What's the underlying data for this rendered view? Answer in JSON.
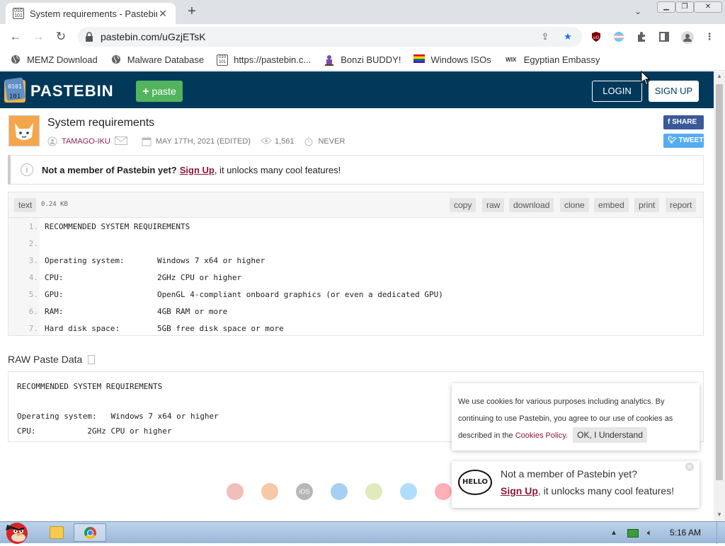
{
  "browser": {
    "tab_title": "System requirements - Pastebin",
    "tab_close": "✕",
    "new_tab": "+",
    "url": "pastebin.com/uGzjETsK",
    "bookmarks": [
      {
        "label": "MEMZ Download",
        "icon": "globe-icon"
      },
      {
        "label": "Malware Database",
        "icon": "globe-icon"
      },
      {
        "label": "https://pastebin.c...",
        "icon": "pastebin-icon"
      },
      {
        "label": "Bonzi BUDDY!",
        "icon": "bonzi-icon"
      },
      {
        "label": "Windows ISOs",
        "icon": "rainbow-flag-icon"
      },
      {
        "label": "Egyptian Embassy",
        "icon": "wix-icon"
      }
    ],
    "wix_glyph": "WIX"
  },
  "header": {
    "logo_text": "PASTEBIN",
    "paste_button": "paste",
    "login_button": "LOGIN",
    "signup_button": "SIGN UP",
    "logo_digits": "0101"
  },
  "paste": {
    "title": "System requirements",
    "author": "TAMAGO-IKU",
    "date": "MAY 17TH, 2021 (EDITED)",
    "views": "1,561",
    "expiry": "NEVER",
    "share_label": "SHARE",
    "tweet_label": "TWEET"
  },
  "notice": {
    "bold_text": "Not a member of Pastebin yet?",
    "link_text": "Sign Up",
    "rest_text": ", it unlocks many cool features!"
  },
  "code": {
    "syntax": "text",
    "size": "0.24 KB",
    "actions": [
      "copy",
      "raw",
      "download",
      "clone",
      "embed",
      "print",
      "report"
    ],
    "line_numbers": [
      "1.",
      "2.",
      "3.",
      "4.",
      "5.",
      "6.",
      "7."
    ],
    "lines": [
      "RECOMMENDED SYSTEM REQUIREMENTS",
      "",
      "Operating system:       Windows 7 x64 or higher",
      "CPU:                    2GHz CPU or higher",
      "GPU:                    OpenGL 4-compliant onboard graphics (or even a dedicated GPU)",
      "RAM:                    4GB RAM or more",
      "Hard disk space:        5GB free disk space or more"
    ]
  },
  "raw": {
    "title": "RAW Paste Data",
    "lines": [
      "RECOMMENDED SYSTEM REQUIREMENTS",
      "",
      "Operating system:   Windows 7 x64 or higher",
      "CPU:           2GHz CPU or higher"
    ]
  },
  "cookie": {
    "text": "We use cookies for various purposes including analytics. By continuing to use Pastebin, you agree to our use of cookies as described in the ",
    "link": "Cookies Policy",
    "after": ".",
    "button": "OK, I Understand"
  },
  "hello_popup": {
    "bubble": "HELLO",
    "line1": "Not a member of Pastebin yet?",
    "link": "Sign Up",
    "line2_rest": ", it unlocks many cool features!"
  },
  "taskbar": {
    "clock": "5:16 AM"
  },
  "colors": {
    "header_bg": "#02395a",
    "paste_green": "#54b45e",
    "link_maroon": "#8b1a3a",
    "facebook": "#3b5998",
    "twitter": "#55acee"
  }
}
